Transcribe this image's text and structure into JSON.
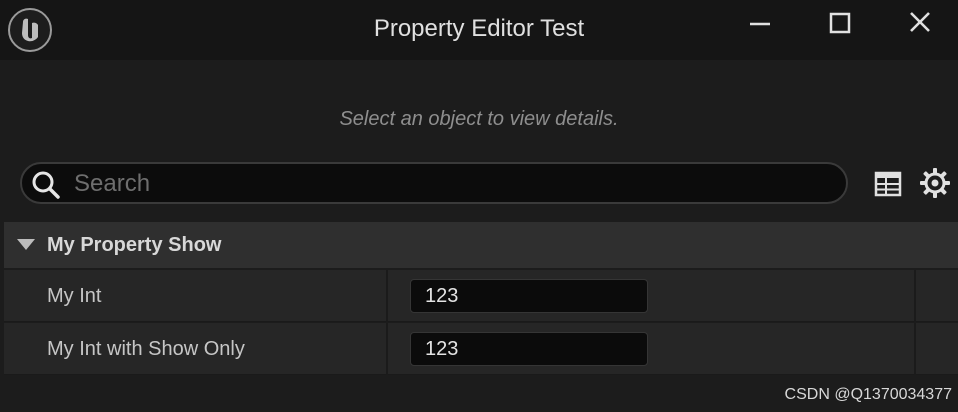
{
  "window": {
    "title": "Property Editor Test",
    "logo_icon": "unreal-engine-logo-icon",
    "controls": [
      "minimize-icon",
      "maximize-icon",
      "close-icon"
    ]
  },
  "details": {
    "empty_message": "Select an object to view details.",
    "search": {
      "placeholder": "Search",
      "value": ""
    },
    "toolbar_icons": [
      "table-view-icon",
      "gear-icon"
    ],
    "category": {
      "label": "My Property Show",
      "expanded": true
    },
    "properties": [
      {
        "name": "My Int",
        "value": "123"
      },
      {
        "name": "My Int with Show Only",
        "value": "123"
      }
    ]
  },
  "watermark": "CSDN @Q1370034377",
  "colors": {
    "titlebar": "#151515",
    "panel": "#1c1c1c",
    "category_header": "#2f2f2f",
    "row": "#262626",
    "input_bg": "#0b0b0b"
  }
}
